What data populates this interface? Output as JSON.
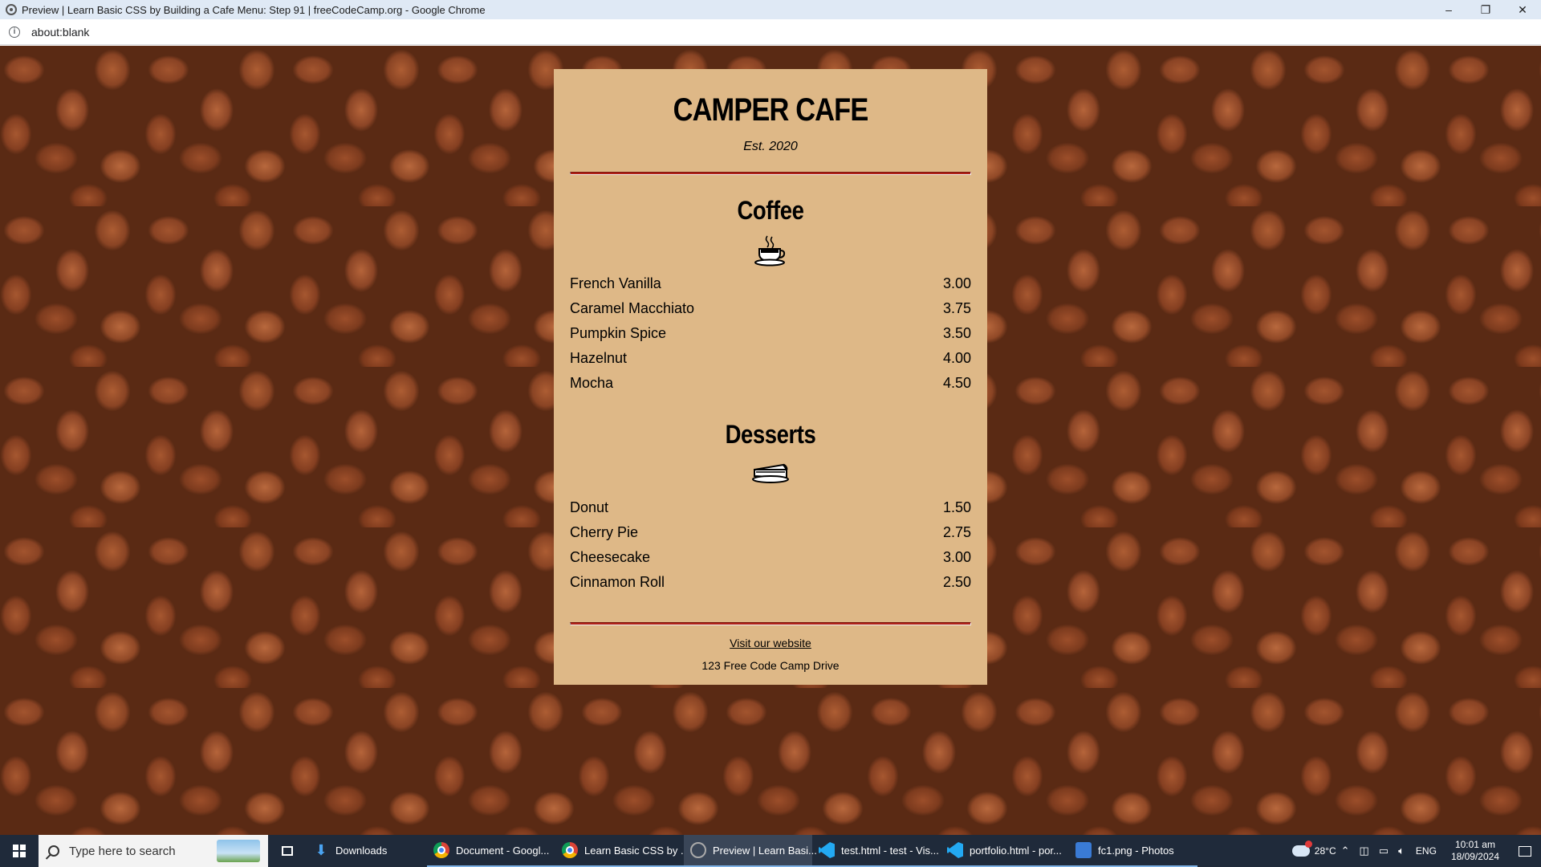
{
  "window": {
    "title": "Preview | Learn Basic CSS by Building a Cafe Menu: Step 91 | freeCodeCamp.org - Google Chrome",
    "minimize": "–",
    "restore": "❐",
    "close": "✕"
  },
  "address_bar": {
    "info_icon": "i",
    "url": "about:blank"
  },
  "menu": {
    "cafe_name": "CAMPER CAFE",
    "established": "Est. 2020",
    "sections": {
      "coffee": {
        "title": "Coffee",
        "icon": "coffee-cup-icon",
        "items": [
          {
            "flavor": "French Vanilla",
            "price": "3.00"
          },
          {
            "flavor": "Caramel Macchiato",
            "price": "3.75"
          },
          {
            "flavor": "Pumpkin Spice",
            "price": "3.50"
          },
          {
            "flavor": "Hazelnut",
            "price": "4.00"
          },
          {
            "flavor": "Mocha",
            "price": "4.50"
          }
        ]
      },
      "desserts": {
        "title": "Desserts",
        "icon": "pie-slice-icon",
        "items": [
          {
            "dessert": "Donut",
            "price": "1.50"
          },
          {
            "dessert": "Cherry Pie",
            "price": "2.75"
          },
          {
            "dessert": "Cheesecake",
            "price": "3.00"
          },
          {
            "dessert": "Cinnamon Roll",
            "price": "2.50"
          }
        ]
      }
    },
    "footer": {
      "link_text": "Visit our website",
      "address": "123 Free Code Camp Drive"
    },
    "colors": {
      "card": "#deb887",
      "divider": "#b02318"
    }
  },
  "taskbar": {
    "search_placeholder": "Type here to search",
    "items": [
      {
        "label": "Downloads",
        "icon": "download-folder-icon"
      },
      {
        "label": "Document - Googl...",
        "icon": "chrome-icon"
      },
      {
        "label": "Learn Basic CSS by ...",
        "icon": "chrome-icon"
      },
      {
        "label": "Preview | Learn Basi...",
        "icon": "globe-icon"
      },
      {
        "label": "test.html - test - Vis...",
        "icon": "vscode-icon"
      },
      {
        "label": "portfolio.html - por...",
        "icon": "vscode-icon"
      },
      {
        "label": "fc1.png - Photos",
        "icon": "photos-icon"
      }
    ],
    "tray": {
      "temperature": "28°C",
      "language": "ENG",
      "time": "10:01 am",
      "date": "18/09/2024"
    },
    "accent": "#7fb2e5"
  }
}
